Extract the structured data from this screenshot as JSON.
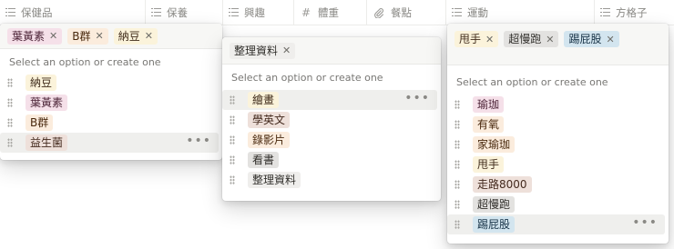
{
  "columns": [
    {
      "label": "保健品",
      "icon": "list-icon"
    },
    {
      "label": "保養",
      "icon": "list-icon"
    },
    {
      "label": "興趣",
      "icon": "list-icon"
    },
    {
      "label": "體重",
      "icon": "hash-icon"
    },
    {
      "label": "餐點",
      "icon": "attachment-icon"
    },
    {
      "label": "運動",
      "icon": "list-icon"
    },
    {
      "label": "方格子",
      "icon": "list-icon"
    }
  ],
  "hint_text": "Select an option or create one",
  "popup1": {
    "selected": [
      {
        "label": "葉黃素",
        "color": "pink"
      },
      {
        "label": "B群",
        "color": "orange"
      },
      {
        "label": "納豆",
        "color": "yellow"
      }
    ],
    "options": [
      {
        "label": "納豆",
        "color": "yellow"
      },
      {
        "label": "葉黃素",
        "color": "pink"
      },
      {
        "label": "B群",
        "color": "orange"
      },
      {
        "label": "益生菌",
        "color": "brown",
        "highlighted": true
      }
    ]
  },
  "popup2": {
    "selected": [
      {
        "label": "整理資料",
        "color": "light"
      }
    ],
    "options": [
      {
        "label": "繪畫",
        "color": "yellow",
        "highlighted": true
      },
      {
        "label": "學英文",
        "color": "brown"
      },
      {
        "label": "錄影片",
        "color": "orange"
      },
      {
        "label": "看書",
        "color": "gray"
      },
      {
        "label": "整理資料",
        "color": "light"
      }
    ]
  },
  "popup3": {
    "selected": [
      {
        "label": "甩手",
        "color": "yellow"
      },
      {
        "label": "超慢跑",
        "color": "gray"
      },
      {
        "label": "踢屁股",
        "color": "blue"
      }
    ],
    "options": [
      {
        "label": "瑜珈",
        "color": "pink"
      },
      {
        "label": "有氧",
        "color": "orange"
      },
      {
        "label": "家瑜珈",
        "color": "orange"
      },
      {
        "label": "甩手",
        "color": "yellow"
      },
      {
        "label": "走路8000",
        "color": "brown"
      },
      {
        "label": "超慢跑",
        "color": "gray"
      },
      {
        "label": "踢屁股",
        "color": "blue",
        "highlighted": true
      }
    ]
  },
  "more_glyph": "•••",
  "remove_glyph": "✕"
}
